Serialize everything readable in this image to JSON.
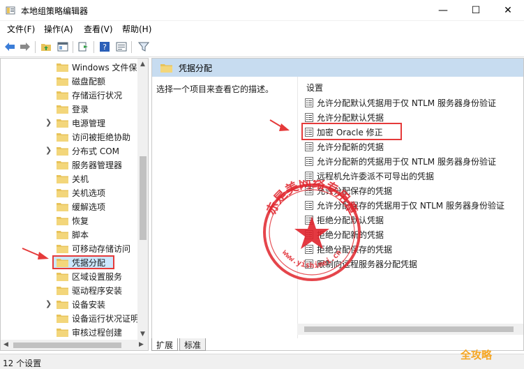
{
  "window": {
    "title": "本地组策略编辑器",
    "min_glyph": "—",
    "max_glyph": "☐",
    "close_glyph": "✕"
  },
  "menu": [
    {
      "label": "文件(F)"
    },
    {
      "label": "操作(A)"
    },
    {
      "label": "查看(V)"
    },
    {
      "label": "帮助(H)"
    }
  ],
  "toolbar": [
    "back-icon",
    "forward-icon",
    "up-folder-icon",
    "show-tree-icon",
    "export-icon",
    "help-icon",
    "properties-icon",
    "filter-icon"
  ],
  "tree": {
    "items": [
      {
        "label": "Windows 文件保",
        "expandable": false
      },
      {
        "label": "磁盘配额",
        "expandable": false
      },
      {
        "label": "存储运行状况",
        "expandable": false
      },
      {
        "label": "登录",
        "expandable": false
      },
      {
        "label": "电源管理",
        "expandable": true
      },
      {
        "label": "访问被拒绝协助",
        "expandable": false
      },
      {
        "label": "分布式 COM",
        "expandable": true
      },
      {
        "label": "服务器管理器",
        "expandable": false
      },
      {
        "label": "关机",
        "expandable": false
      },
      {
        "label": "关机选项",
        "expandable": false
      },
      {
        "label": "缓解选项",
        "expandable": false
      },
      {
        "label": "恢复",
        "expandable": false
      },
      {
        "label": "脚本",
        "expandable": false
      },
      {
        "label": "可移动存储访问",
        "expandable": false
      },
      {
        "label": "凭据分配",
        "expandable": false,
        "selected": true
      },
      {
        "label": "区域设置服务",
        "expandable": false
      },
      {
        "label": "驱动程序安装",
        "expandable": false
      },
      {
        "label": "设备安装",
        "expandable": true
      },
      {
        "label": "设备运行状况证明",
        "expandable": false
      },
      {
        "label": "审核过程创建",
        "expandable": false
      }
    ]
  },
  "details": {
    "header": "凭据分配",
    "description": "选择一个项目来查看它的描述。",
    "column_header": "设置",
    "settings": [
      {
        "label": "允许分配默认凭据用于仅 NTLM 服务器身份验证"
      },
      {
        "label": "允许分配默认凭据"
      },
      {
        "label": "加密 Oracle 修正",
        "highlighted": true
      },
      {
        "label": "允许分配新的凭据"
      },
      {
        "label": "允许分配新的凭据用于仅 NTLM 服务器身份验证"
      },
      {
        "label": "远程机允许委派不可导出的凭据"
      },
      {
        "label": "允许分配保存的凭据"
      },
      {
        "label": "允许分配保存的凭据用于仅 NTLM 服务器身份验证"
      },
      {
        "label": "拒绝分配默认凭据"
      },
      {
        "label": "拒绝分配新的凭据"
      },
      {
        "label": "拒绝分配保存的凭据"
      },
      {
        "label": "限制向远程服务器分配凭据"
      }
    ]
  },
  "tabs": [
    {
      "label": "扩展"
    },
    {
      "label": "标准"
    }
  ],
  "status": {
    "text": "12 个设置"
  },
  "watermark": {
    "stamp_text": "赤是美网络专用章",
    "stamp_url": "www.yishimei.cn",
    "logo_text": "全攻略"
  },
  "colors": {
    "accent_red": "#e53a3a",
    "header_blue": "#c7dcf0",
    "selection_blue": "#cce8ff",
    "folder_yellow": "#e8c35a"
  }
}
